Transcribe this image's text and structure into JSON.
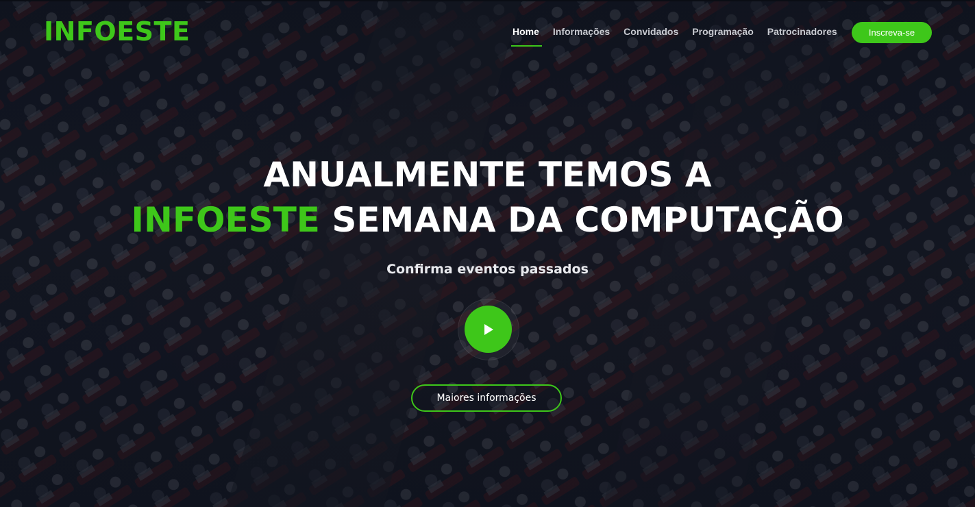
{
  "brand": {
    "name": "INFOESTE",
    "accent_color": "#3ec71a"
  },
  "nav": {
    "items": [
      {
        "label": "Home",
        "active": true
      },
      {
        "label": "Informações",
        "active": false
      },
      {
        "label": "Convidados",
        "active": false
      },
      {
        "label": "Programação",
        "active": false
      },
      {
        "label": "Patrocinadores",
        "active": false
      }
    ],
    "cta_label": "Inscreva-se"
  },
  "hero": {
    "line1": "ANUALMENTE TEMOS A",
    "line2_highlight": "INFOESTE",
    "line2_rest": " SEMANA DA COMPUTAÇÃO",
    "subtitle": "Confirma eventos passados",
    "play_icon": "play-icon",
    "more_label": "Maiores informações"
  }
}
